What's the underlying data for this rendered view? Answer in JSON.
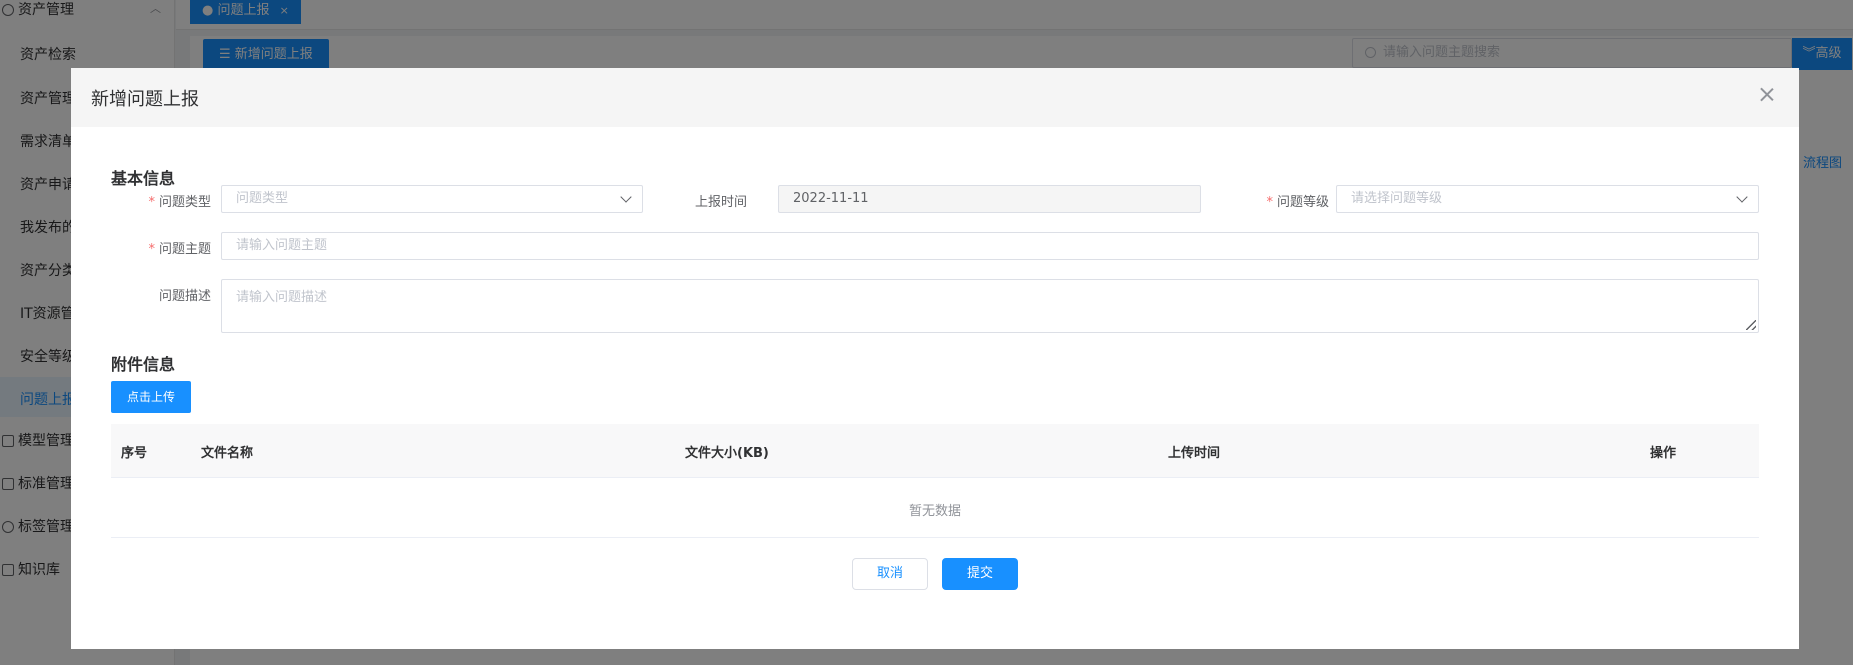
{
  "sidebar": {
    "group_asset": "资产管理",
    "items": [
      "资产检索",
      "资产管理",
      "需求清单",
      "资产申请",
      "我发布的",
      "资产分类",
      "IT资源管",
      "安全等级",
      "问题上报"
    ],
    "groups_bottom": [
      "模型管理",
      "标准管理",
      "标签管理",
      "知识库"
    ]
  },
  "tabbar": {
    "active_tab": "问题上报",
    "tab_close": "×"
  },
  "toolbar": {
    "new_button": "新增问题上报",
    "search_placeholder": "请输入问题主题搜索",
    "advanced_button": "高级",
    "flow_link": "流程图"
  },
  "modal": {
    "title": "新增问题上报",
    "section_basic": "基本信息",
    "fields": {
      "issue_type": {
        "label": "问题类型",
        "placeholder": "问题类型"
      },
      "report_time": {
        "label": "上报时间",
        "value": "2022-11-11"
      },
      "issue_level": {
        "label": "问题等级",
        "placeholder": "请选择问题等级"
      },
      "issue_subject": {
        "label": "问题主题",
        "placeholder": "请输入问题主题"
      },
      "issue_desc": {
        "label": "问题描述",
        "placeholder": "请输入问题描述"
      }
    },
    "required_mark": "*",
    "section_attach": "附件信息",
    "upload_button": "点击上传",
    "table": {
      "columns": [
        "序号",
        "文件名称",
        "文件大小(KB)",
        "上传时间",
        "操作"
      ],
      "empty_text": "暂无数据"
    },
    "cancel_button": "取消",
    "submit_button": "提交"
  }
}
